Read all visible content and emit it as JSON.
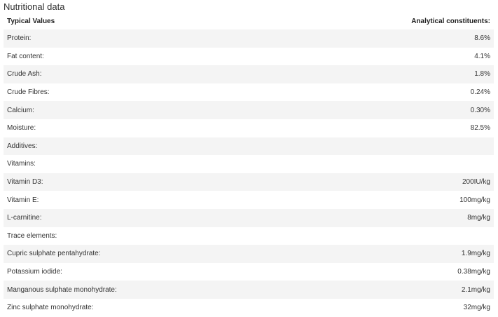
{
  "title": "Nutritional data",
  "headers": {
    "left": "Typical Values",
    "right": "Analytical constituents:"
  },
  "rows": [
    {
      "label": "Protein:",
      "value": "8.6%"
    },
    {
      "label": "Fat content:",
      "value": "4.1%"
    },
    {
      "label": "Crude Ash:",
      "value": "1.8%"
    },
    {
      "label": "Crude Fibres:",
      "value": "0.24%"
    },
    {
      "label": "Calcium:",
      "value": "0.30%"
    },
    {
      "label": "Moisture:",
      "value": "82.5%"
    },
    {
      "label": "Additives:",
      "value": ""
    },
    {
      "label": "Vitamins:",
      "value": ""
    },
    {
      "label": "Vitamin D3:",
      "value": "200IU/kg"
    },
    {
      "label": "Vitamin E:",
      "value": "100mg/kg"
    },
    {
      "label": "L-carnitine:",
      "value": "8mg/kg"
    },
    {
      "label": "Trace elements:",
      "value": ""
    },
    {
      "label": "Cupric sulphate pentahydrate:",
      "value": "1.9mg/kg"
    },
    {
      "label": "Potassium iodide:",
      "value": "0.38mg/kg"
    },
    {
      "label": "Manganous sulphate monohydrate:",
      "value": "2.1mg/kg"
    },
    {
      "label": "Zinc sulphate monohydrate:",
      "value": "32mg/kg"
    }
  ]
}
